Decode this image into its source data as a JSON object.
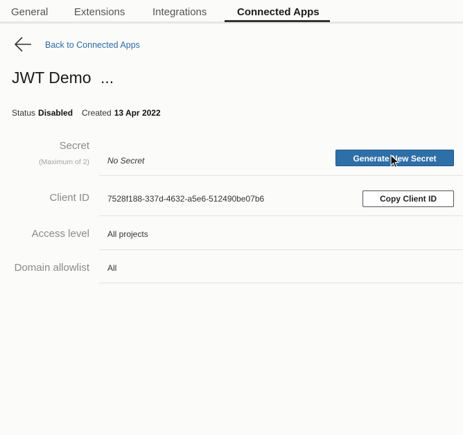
{
  "tabs": [
    {
      "label": "General"
    },
    {
      "label": "Extensions"
    },
    {
      "label": "Integrations"
    },
    {
      "label": "Connected Apps",
      "active": true
    }
  ],
  "back": {
    "label": "Back to Connected Apps",
    "icon": "arrow-left-icon"
  },
  "title": {
    "text": "JWT Demo",
    "more": "..."
  },
  "meta": {
    "status_label": "Status",
    "status_value": "Disabled",
    "created_label": "Created",
    "created_value": "13 Apr 2022"
  },
  "details": {
    "secret": {
      "label": "Secret",
      "sublabel": "(Maximum of 2)",
      "value": "No Secret",
      "button": "Generate New Secret"
    },
    "client_id": {
      "label": "Client ID",
      "value": "7528f188-337d-4632-a5e6-512490be07b6",
      "button": "Copy Client ID"
    },
    "access_level": {
      "label": "Access level",
      "value": "All projects"
    },
    "domain_allowlist": {
      "label": "Domain allowlist",
      "value": "All"
    }
  },
  "colors": {
    "primary_button": "#2e6fa8",
    "link": "#2d6aa6",
    "background": "#fbfbfa"
  }
}
